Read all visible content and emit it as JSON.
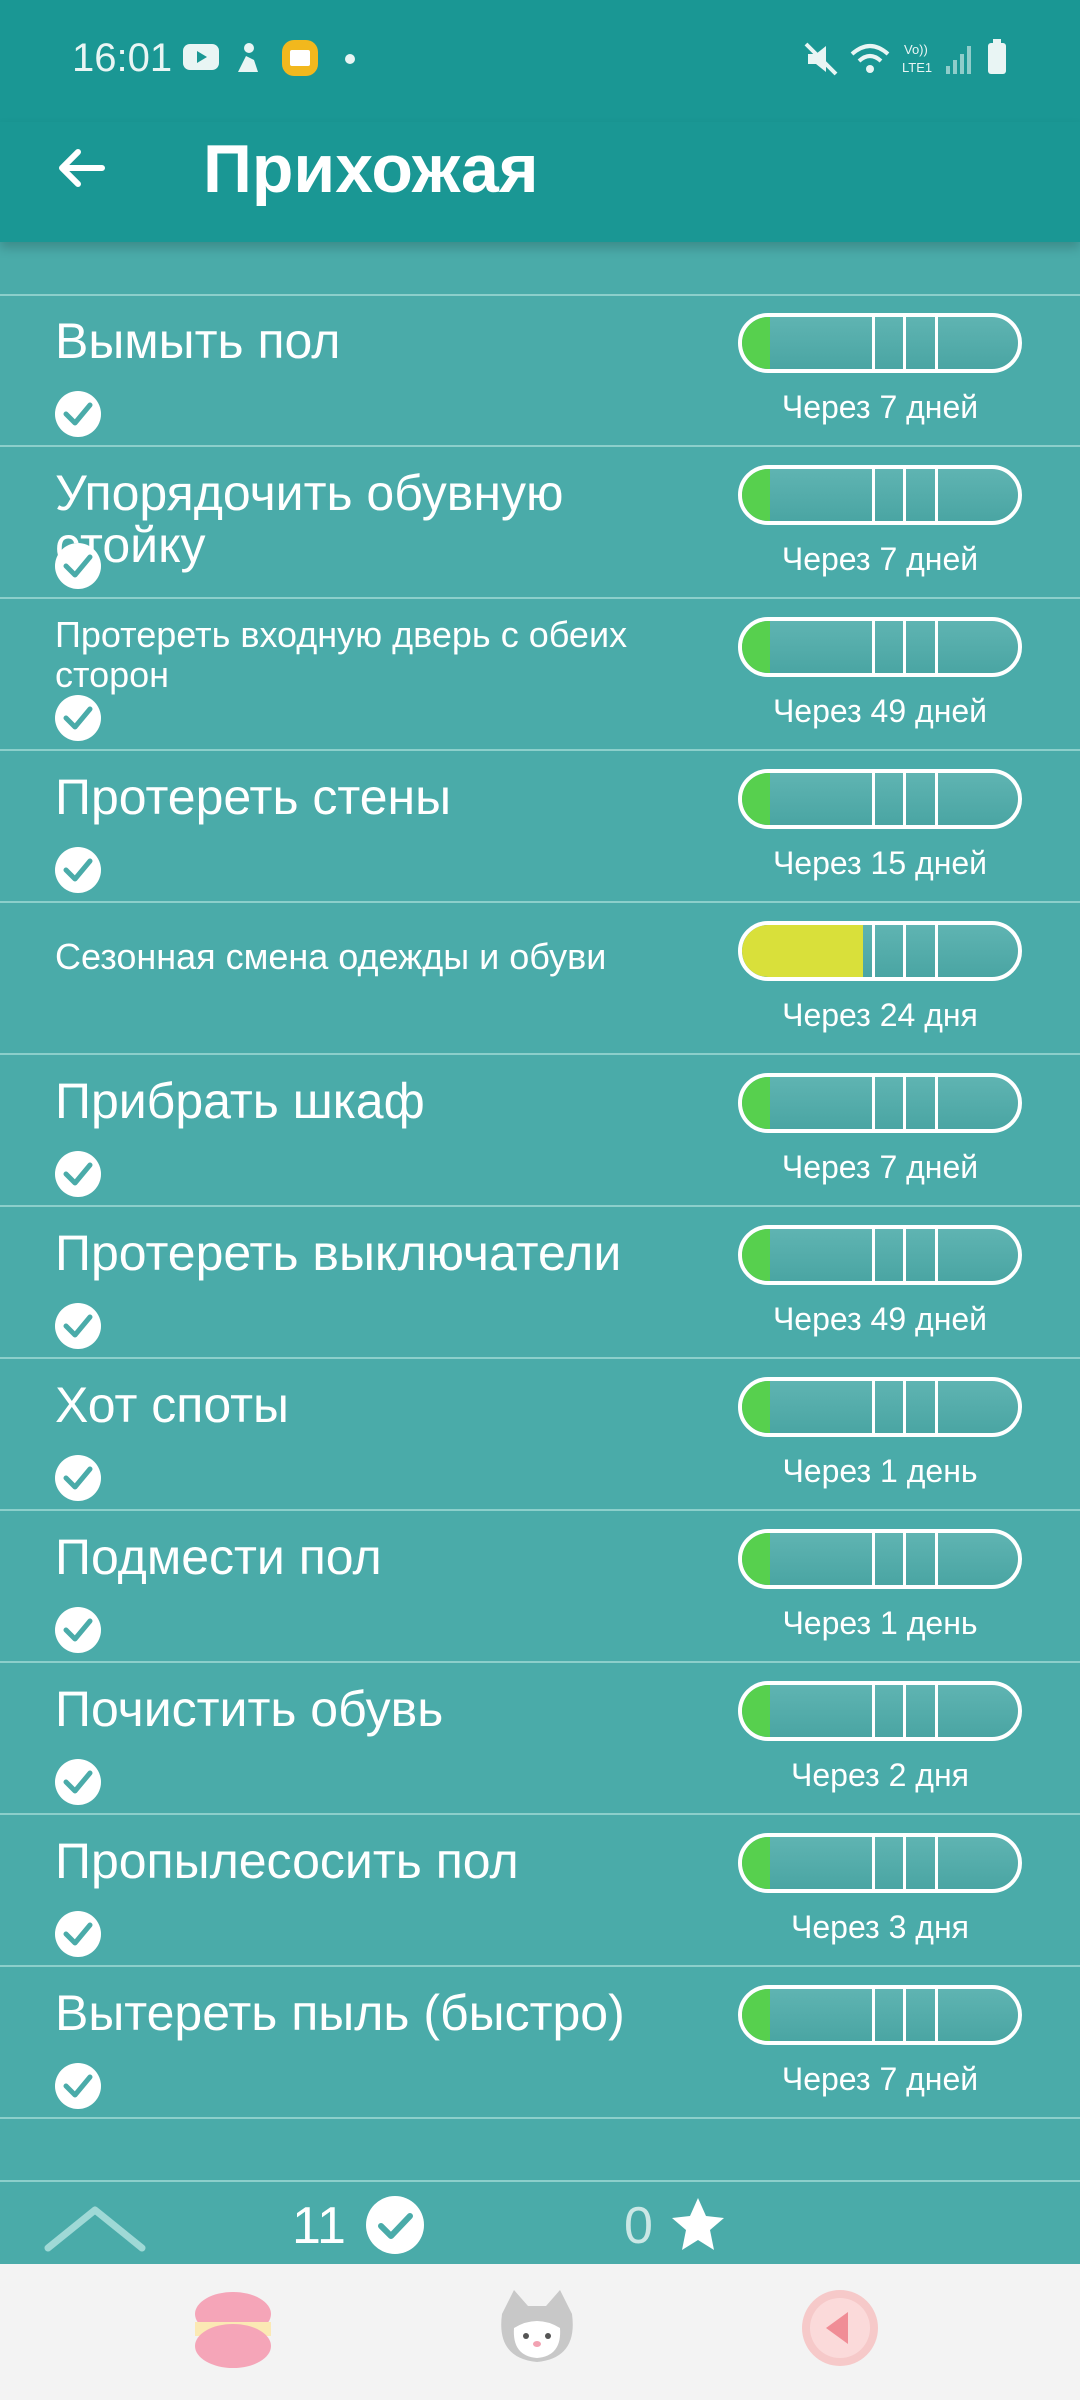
{
  "status_bar": {
    "time": "16:01",
    "icons": [
      "youtube-icon",
      "figure-icon",
      "notes-icon",
      "dot-icon",
      "mute-icon",
      "wifi-icon",
      "volte-lte-icon",
      "signal-icon",
      "battery-icon"
    ]
  },
  "header": {
    "title": "Прихожая",
    "back_icon": "arrow-left-icon"
  },
  "tasks": [
    {
      "name": "Вымыть пол",
      "due": "Через 7 дней",
      "progress": 0.1,
      "color": "#57d04e"
    },
    {
      "name": "Упорядочить обувную стойку",
      "due": "Через 7 дней",
      "progress": 0.1,
      "color": "#57d04e"
    },
    {
      "name": "Протереть входную дверь с обеих сторон",
      "due": "Через 49 дней",
      "progress": 0.1,
      "color": "#57d04e"
    },
    {
      "name": "Протереть стены",
      "due": "Через 15 дней",
      "progress": 0.1,
      "color": "#57d04e"
    },
    {
      "name": "Сезонная смена одежды и обуви",
      "due": "Через 24 дня",
      "progress": 0.44,
      "color": "#d9e03a"
    },
    {
      "name": "Прибрать шкаф",
      "due": "Через 7 дней",
      "progress": 0.1,
      "color": "#57d04e"
    },
    {
      "name": "Протереть выключатели",
      "due": "Через 49 дней",
      "progress": 0.1,
      "color": "#57d04e"
    },
    {
      "name": "Хот споты",
      "due": "Через 1 день",
      "progress": 0.1,
      "color": "#57d04e"
    },
    {
      "name": "Подмести пол",
      "due": "Через 1 день",
      "progress": 0.1,
      "color": "#57d04e"
    },
    {
      "name": "Почистить обувь",
      "due": "Через 2 дня",
      "progress": 0.1,
      "color": "#57d04e"
    },
    {
      "name": "Пропылесосить пол",
      "due": "Через 3 дня",
      "progress": 0.1,
      "color": "#57d04e"
    },
    {
      "name": "Вытереть пыль (быстро)",
      "due": "Через 7 дней",
      "progress": 0.1,
      "color": "#57d04e"
    }
  ],
  "footer": {
    "done_count": "11",
    "star_count": "0"
  },
  "nav": {
    "items": [
      "macaron-icon",
      "cat-icon",
      "back-play-icon"
    ]
  }
}
